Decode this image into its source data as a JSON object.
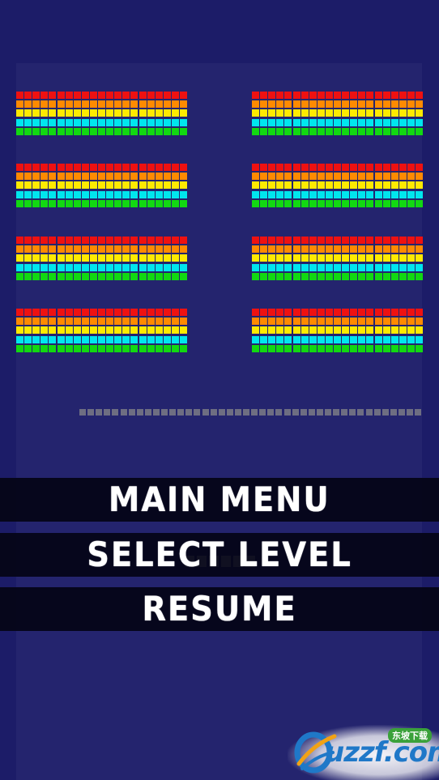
{
  "menu": {
    "items": [
      {
        "id": "main-menu",
        "label": "MAIN MENU"
      },
      {
        "id": "select-level",
        "label": "SELECT LEVEL"
      },
      {
        "id": "resume",
        "label": "RESUME"
      }
    ]
  },
  "brick_wall": {
    "row_colors": [
      "#ee1111",
      "#ff8a00",
      "#ffea00",
      "#00e6ee",
      "#12d812"
    ],
    "group_rows": 4,
    "group_columns": 2,
    "bricks_per_row": 21
  },
  "ground": {
    "color": "#6e6e82",
    "segments": 42
  },
  "paddle": {
    "color": "#a7a7b7",
    "segments": 6
  },
  "watermark": {
    "logo_text": "uzzf.com",
    "badge_text": "东坡下载"
  },
  "colors": {
    "background": "#1c1c68",
    "playfield": "#24246e",
    "menu_bar": "#04041a",
    "menu_text": "#ffffff"
  }
}
